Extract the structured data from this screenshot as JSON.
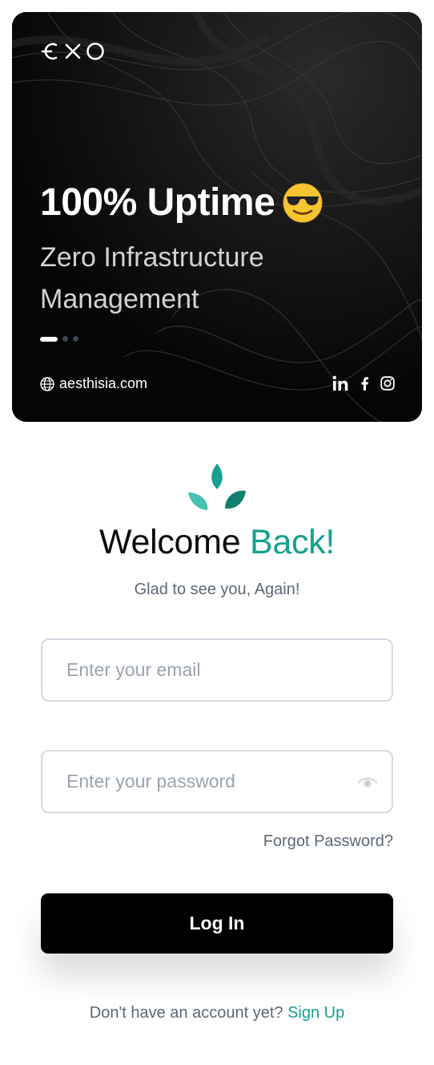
{
  "hero": {
    "brand": "exo",
    "title": "100% Uptime",
    "emoji": "smiling-face-with-sunglasses-emoji",
    "subtitle": "Zero Infrastructure Management",
    "carousel_total": 3,
    "carousel_active": 1,
    "website": "aesthisia.com",
    "socials": [
      "linkedin-icon",
      "facebook-icon",
      "instagram-icon"
    ]
  },
  "auth": {
    "heading_main": "Welcome",
    "heading_accent": "Back!",
    "subheading": "Glad to see you, Again!",
    "email_placeholder": "Enter your email",
    "email_value": "",
    "password_placeholder": "Enter your password",
    "password_value": "",
    "forgot_label": "Forgot Password?",
    "login_label": "Log In",
    "signup_prompt": "Don't have an account yet?",
    "signup_label": "Sign Up"
  },
  "colors": {
    "accent": "#14a190",
    "primary_button": "#000000",
    "muted_text": "#5d6775",
    "hero_bg": "#0a0a0a"
  }
}
